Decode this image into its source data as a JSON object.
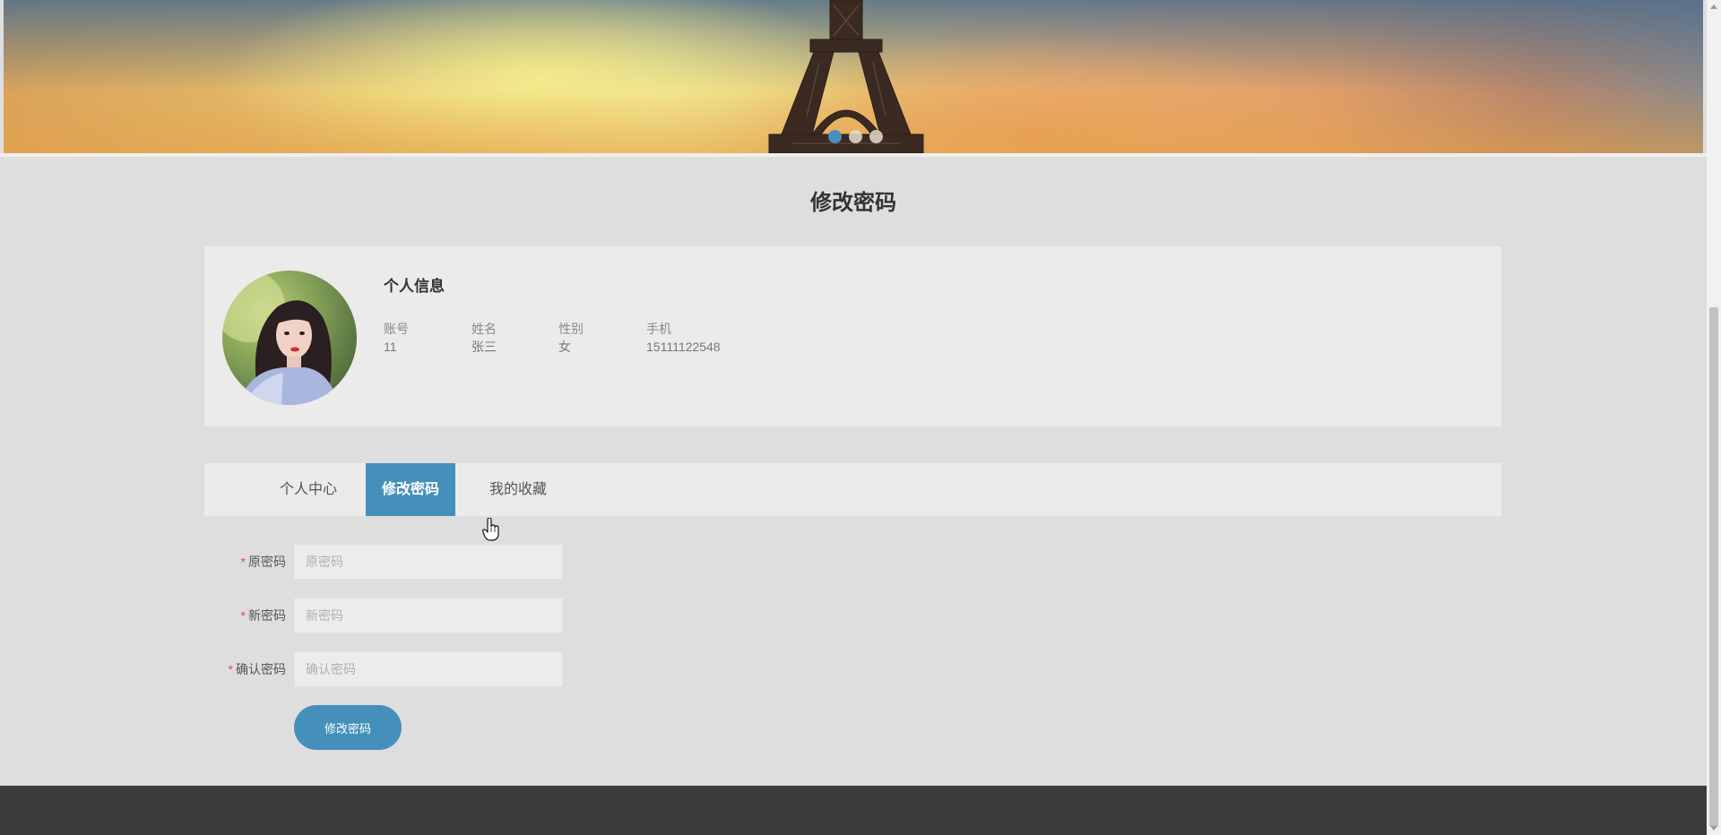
{
  "banner": {
    "slide_count": 3,
    "active_slide": 1
  },
  "page": {
    "title": "修改密码"
  },
  "profile": {
    "heading": "个人信息",
    "fields": [
      {
        "label": "账号",
        "value": "11"
      },
      {
        "label": "姓名",
        "value": "张三"
      },
      {
        "label": "性别",
        "value": "女"
      },
      {
        "label": "手机",
        "value": "15111122548"
      }
    ]
  },
  "tabs": [
    {
      "label": "个人中心",
      "active": false
    },
    {
      "label": "修改密码",
      "active": true
    },
    {
      "label": "我的收藏",
      "active": false
    }
  ],
  "form": {
    "old_password": {
      "label": "原密码",
      "placeholder": "原密码",
      "required": true
    },
    "new_password": {
      "label": "新密码",
      "placeholder": "新密码",
      "required": true
    },
    "confirm_password": {
      "label": "确认密码",
      "placeholder": "确认密码",
      "required": true
    },
    "required_mark": "*",
    "submit_label": "修改密码"
  },
  "colors": {
    "accent": "#4590bb",
    "required": "#e24a4a",
    "footer": "#3c3c3c"
  },
  "icons": {
    "cursor": "hand-pointer-icon",
    "scroll_up": "scroll-up-arrow-icon",
    "scroll_down": "scroll-down-arrow-icon"
  }
}
